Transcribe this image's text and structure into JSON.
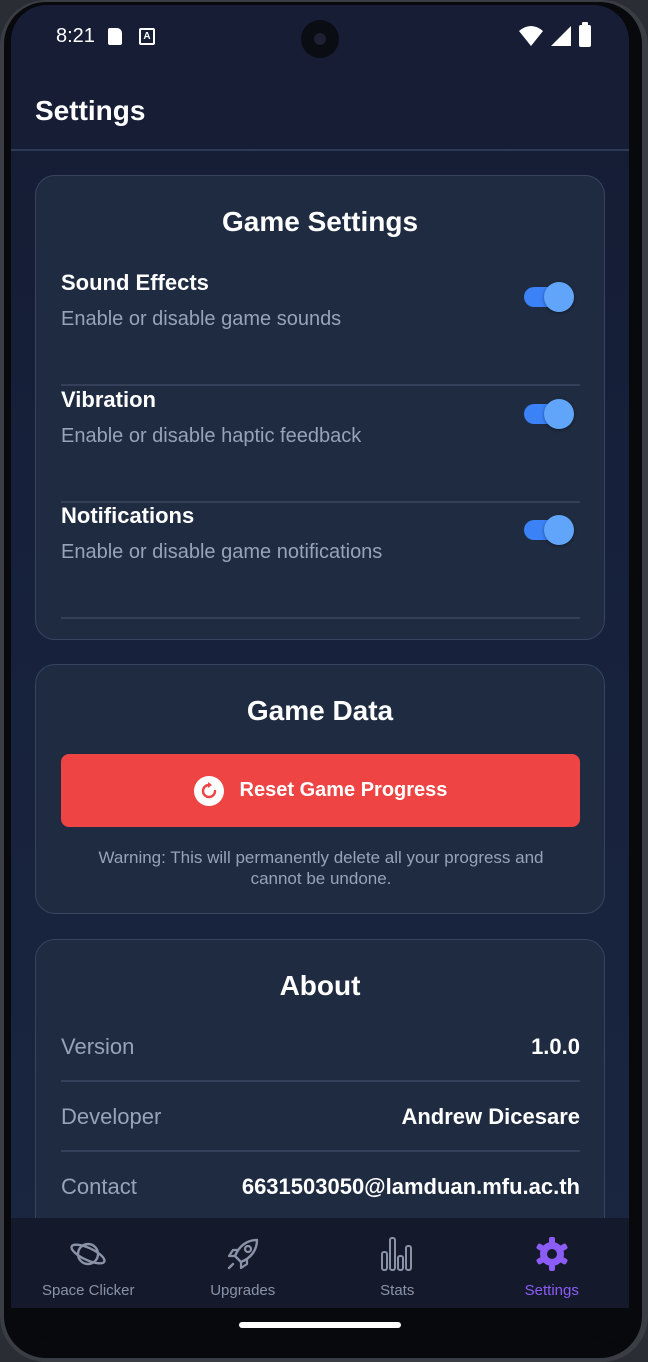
{
  "status_bar": {
    "time": "8:21",
    "a_icon_label": "A"
  },
  "header": {
    "title": "Settings"
  },
  "game_settings": {
    "title": "Game Settings",
    "items": [
      {
        "label": "Sound Effects",
        "description": "Enable or disable game sounds",
        "enabled": true
      },
      {
        "label": "Vibration",
        "description": "Enable or disable haptic feedback",
        "enabled": true
      },
      {
        "label": "Notifications",
        "description": "Enable or disable game notifications",
        "enabled": true
      }
    ]
  },
  "game_data": {
    "title": "Game Data",
    "reset_label": "Reset Game Progress",
    "warning": "Warning: This will permanently delete all your progress and cannot be undone."
  },
  "about": {
    "title": "About",
    "rows": [
      {
        "label": "Version",
        "value": "1.0.0"
      },
      {
        "label": "Developer",
        "value": "Andrew Dicesare"
      },
      {
        "label": "Contact",
        "value": "6631503050@lamduan.mfu.ac.th"
      }
    ]
  },
  "nav": {
    "items": [
      {
        "label": "Space Clicker",
        "icon": "planet-icon"
      },
      {
        "label": "Upgrades",
        "icon": "rocket-icon"
      },
      {
        "label": "Stats",
        "icon": "bar-chart-icon"
      },
      {
        "label": "Settings",
        "icon": "gear-icon"
      }
    ],
    "active_index": 3
  },
  "colors": {
    "accent": "#3b82f6",
    "danger": "#ef4444",
    "active_nav": "#8b5cf6",
    "card_bg": "#1f2b40"
  }
}
